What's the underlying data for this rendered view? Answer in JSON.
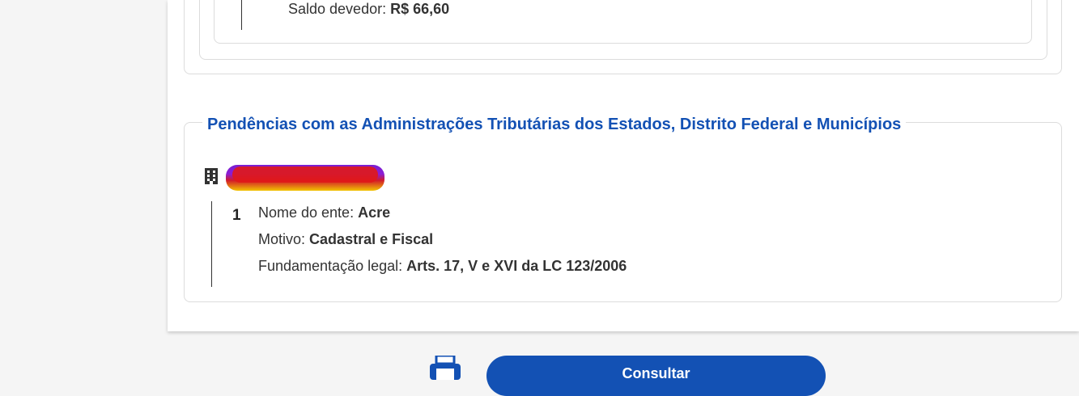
{
  "previous_section": {
    "balance_label": "Saldo devedor:",
    "balance_value": "R$ 66,60"
  },
  "state_section": {
    "title": "Pendências com as Administrações Tributárias dos Estados, Distrito Federal e Municípios",
    "entity_icon": "building-icon",
    "items": [
      {
        "number": "1",
        "ente_label": "Nome do ente:",
        "ente_value": "Acre",
        "motivo_label": "Motivo:",
        "motivo_value": "Cadastral e Fiscal",
        "fundamentacao_label": "Fundamentação legal:",
        "fundamentacao_value": "Arts. 17, V e XVI da LC 123/2006"
      }
    ]
  },
  "footer": {
    "print_icon": "printer-icon",
    "action_button_label": "Consultar"
  },
  "colors": {
    "accent": "#1351b4",
    "border": "#dcdcdc",
    "background": "#f5f5f5"
  }
}
